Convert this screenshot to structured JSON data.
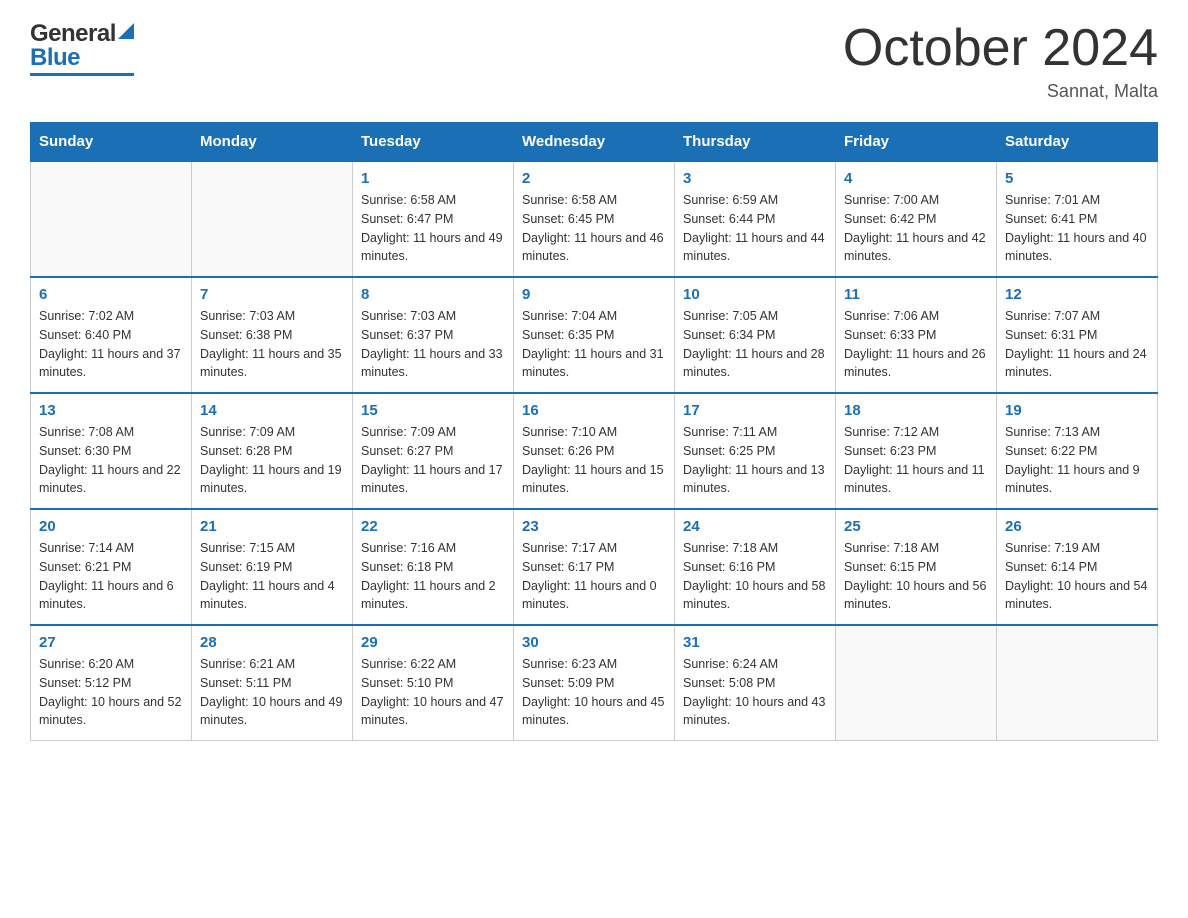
{
  "header": {
    "logo": {
      "general": "General",
      "arrow": "▶",
      "blue": "Blue"
    },
    "title": "October 2024",
    "location": "Sannat, Malta"
  },
  "weekdays": [
    "Sunday",
    "Monday",
    "Tuesday",
    "Wednesday",
    "Thursday",
    "Friday",
    "Saturday"
  ],
  "weeks": [
    [
      {
        "day": "",
        "sunrise": "",
        "sunset": "",
        "daylight": ""
      },
      {
        "day": "",
        "sunrise": "",
        "sunset": "",
        "daylight": ""
      },
      {
        "day": "1",
        "sunrise": "Sunrise: 6:58 AM",
        "sunset": "Sunset: 6:47 PM",
        "daylight": "Daylight: 11 hours and 49 minutes."
      },
      {
        "day": "2",
        "sunrise": "Sunrise: 6:58 AM",
        "sunset": "Sunset: 6:45 PM",
        "daylight": "Daylight: 11 hours and 46 minutes."
      },
      {
        "day": "3",
        "sunrise": "Sunrise: 6:59 AM",
        "sunset": "Sunset: 6:44 PM",
        "daylight": "Daylight: 11 hours and 44 minutes."
      },
      {
        "day": "4",
        "sunrise": "Sunrise: 7:00 AM",
        "sunset": "Sunset: 6:42 PM",
        "daylight": "Daylight: 11 hours and 42 minutes."
      },
      {
        "day": "5",
        "sunrise": "Sunrise: 7:01 AM",
        "sunset": "Sunset: 6:41 PM",
        "daylight": "Daylight: 11 hours and 40 minutes."
      }
    ],
    [
      {
        "day": "6",
        "sunrise": "Sunrise: 7:02 AM",
        "sunset": "Sunset: 6:40 PM",
        "daylight": "Daylight: 11 hours and 37 minutes."
      },
      {
        "day": "7",
        "sunrise": "Sunrise: 7:03 AM",
        "sunset": "Sunset: 6:38 PM",
        "daylight": "Daylight: 11 hours and 35 minutes."
      },
      {
        "day": "8",
        "sunrise": "Sunrise: 7:03 AM",
        "sunset": "Sunset: 6:37 PM",
        "daylight": "Daylight: 11 hours and 33 minutes."
      },
      {
        "day": "9",
        "sunrise": "Sunrise: 7:04 AM",
        "sunset": "Sunset: 6:35 PM",
        "daylight": "Daylight: 11 hours and 31 minutes."
      },
      {
        "day": "10",
        "sunrise": "Sunrise: 7:05 AM",
        "sunset": "Sunset: 6:34 PM",
        "daylight": "Daylight: 11 hours and 28 minutes."
      },
      {
        "day": "11",
        "sunrise": "Sunrise: 7:06 AM",
        "sunset": "Sunset: 6:33 PM",
        "daylight": "Daylight: 11 hours and 26 minutes."
      },
      {
        "day": "12",
        "sunrise": "Sunrise: 7:07 AM",
        "sunset": "Sunset: 6:31 PM",
        "daylight": "Daylight: 11 hours and 24 minutes."
      }
    ],
    [
      {
        "day": "13",
        "sunrise": "Sunrise: 7:08 AM",
        "sunset": "Sunset: 6:30 PM",
        "daylight": "Daylight: 11 hours and 22 minutes."
      },
      {
        "day": "14",
        "sunrise": "Sunrise: 7:09 AM",
        "sunset": "Sunset: 6:28 PM",
        "daylight": "Daylight: 11 hours and 19 minutes."
      },
      {
        "day": "15",
        "sunrise": "Sunrise: 7:09 AM",
        "sunset": "Sunset: 6:27 PM",
        "daylight": "Daylight: 11 hours and 17 minutes."
      },
      {
        "day": "16",
        "sunrise": "Sunrise: 7:10 AM",
        "sunset": "Sunset: 6:26 PM",
        "daylight": "Daylight: 11 hours and 15 minutes."
      },
      {
        "day": "17",
        "sunrise": "Sunrise: 7:11 AM",
        "sunset": "Sunset: 6:25 PM",
        "daylight": "Daylight: 11 hours and 13 minutes."
      },
      {
        "day": "18",
        "sunrise": "Sunrise: 7:12 AM",
        "sunset": "Sunset: 6:23 PM",
        "daylight": "Daylight: 11 hours and 11 minutes."
      },
      {
        "day": "19",
        "sunrise": "Sunrise: 7:13 AM",
        "sunset": "Sunset: 6:22 PM",
        "daylight": "Daylight: 11 hours and 9 minutes."
      }
    ],
    [
      {
        "day": "20",
        "sunrise": "Sunrise: 7:14 AM",
        "sunset": "Sunset: 6:21 PM",
        "daylight": "Daylight: 11 hours and 6 minutes."
      },
      {
        "day": "21",
        "sunrise": "Sunrise: 7:15 AM",
        "sunset": "Sunset: 6:19 PM",
        "daylight": "Daylight: 11 hours and 4 minutes."
      },
      {
        "day": "22",
        "sunrise": "Sunrise: 7:16 AM",
        "sunset": "Sunset: 6:18 PM",
        "daylight": "Daylight: 11 hours and 2 minutes."
      },
      {
        "day": "23",
        "sunrise": "Sunrise: 7:17 AM",
        "sunset": "Sunset: 6:17 PM",
        "daylight": "Daylight: 11 hours and 0 minutes."
      },
      {
        "day": "24",
        "sunrise": "Sunrise: 7:18 AM",
        "sunset": "Sunset: 6:16 PM",
        "daylight": "Daylight: 10 hours and 58 minutes."
      },
      {
        "day": "25",
        "sunrise": "Sunrise: 7:18 AM",
        "sunset": "Sunset: 6:15 PM",
        "daylight": "Daylight: 10 hours and 56 minutes."
      },
      {
        "day": "26",
        "sunrise": "Sunrise: 7:19 AM",
        "sunset": "Sunset: 6:14 PM",
        "daylight": "Daylight: 10 hours and 54 minutes."
      }
    ],
    [
      {
        "day": "27",
        "sunrise": "Sunrise: 6:20 AM",
        "sunset": "Sunset: 5:12 PM",
        "daylight": "Daylight: 10 hours and 52 minutes."
      },
      {
        "day": "28",
        "sunrise": "Sunrise: 6:21 AM",
        "sunset": "Sunset: 5:11 PM",
        "daylight": "Daylight: 10 hours and 49 minutes."
      },
      {
        "day": "29",
        "sunrise": "Sunrise: 6:22 AM",
        "sunset": "Sunset: 5:10 PM",
        "daylight": "Daylight: 10 hours and 47 minutes."
      },
      {
        "day": "30",
        "sunrise": "Sunrise: 6:23 AM",
        "sunset": "Sunset: 5:09 PM",
        "daylight": "Daylight: 10 hours and 45 minutes."
      },
      {
        "day": "31",
        "sunrise": "Sunrise: 6:24 AM",
        "sunset": "Sunset: 5:08 PM",
        "daylight": "Daylight: 10 hours and 43 minutes."
      },
      {
        "day": "",
        "sunrise": "",
        "sunset": "",
        "daylight": ""
      },
      {
        "day": "",
        "sunrise": "",
        "sunset": "",
        "daylight": ""
      }
    ]
  ]
}
